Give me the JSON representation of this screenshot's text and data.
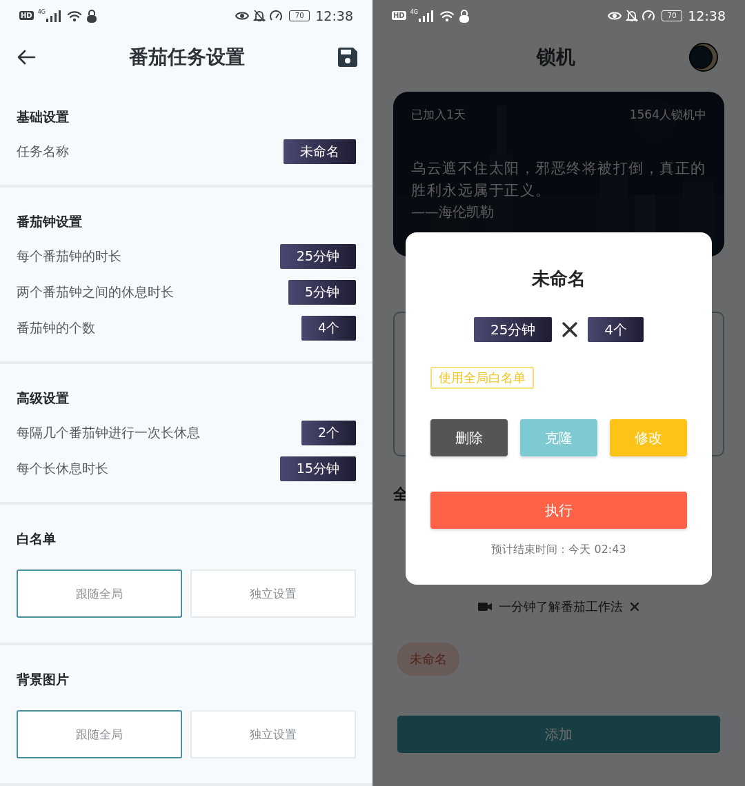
{
  "left": {
    "status_bar": {
      "hd": "HD",
      "network": "4G",
      "battery": "70",
      "time": "12:38"
    },
    "title": "番茄任务设置",
    "sections": [
      {
        "title": "基础设置",
        "kind": "rows",
        "rows": [
          {
            "label": "任务名称",
            "value": "未命名"
          }
        ]
      },
      {
        "title": "番茄钟设置",
        "kind": "rows",
        "rows": [
          {
            "label": "每个番茄钟的时长",
            "value": "25分钟"
          },
          {
            "label": "两个番茄钟之间的休息时长",
            "value": "5分钟"
          },
          {
            "label": "番茄钟的个数",
            "value": "4个"
          }
        ]
      },
      {
        "title": "高级设置",
        "kind": "rows",
        "rows": [
          {
            "label": "每隔几个番茄钟进行一次长休息",
            "value": "2个"
          },
          {
            "label": "每个长休息时长",
            "value": "15分钟"
          }
        ]
      },
      {
        "title": "白名单",
        "kind": "options",
        "options": [
          {
            "label": "跟随全局",
            "selected": true
          },
          {
            "label": "独立设置",
            "selected": false
          }
        ]
      },
      {
        "title": "背景图片",
        "kind": "options",
        "options": [
          {
            "label": "跟随全局",
            "selected": true
          },
          {
            "label": "独立设置",
            "selected": false
          }
        ]
      }
    ]
  },
  "right": {
    "status_bar": {
      "hd": "HD",
      "network": "4G",
      "battery": "70",
      "time": "12:38"
    },
    "title": "锁机",
    "card": {
      "kind": "picture",
      "joined": "已加入1天",
      "online": "1564人锁机中",
      "quote": "乌云遮不住太阳，邪恶终将被打倒，真正的胜利永远属于正义。",
      "author": "——海伦凯勒"
    },
    "partial_heading": "全",
    "video_hint": "一分钟了解番茄工作法",
    "task_tags": [
      {
        "label": "未命名"
      }
    ],
    "add_button": "添加",
    "dialog": {
      "title": "未命名",
      "duration": "25分钟",
      "count": "4个",
      "whitelist_tag": "使用全局白名单",
      "actions": [
        {
          "label": "删除",
          "kind": "delete"
        },
        {
          "label": "克隆",
          "kind": "clone"
        },
        {
          "label": "修改",
          "kind": "edit"
        }
      ],
      "run_button": "执行",
      "estimate": "预计结束时间：今天 02:43"
    }
  }
}
